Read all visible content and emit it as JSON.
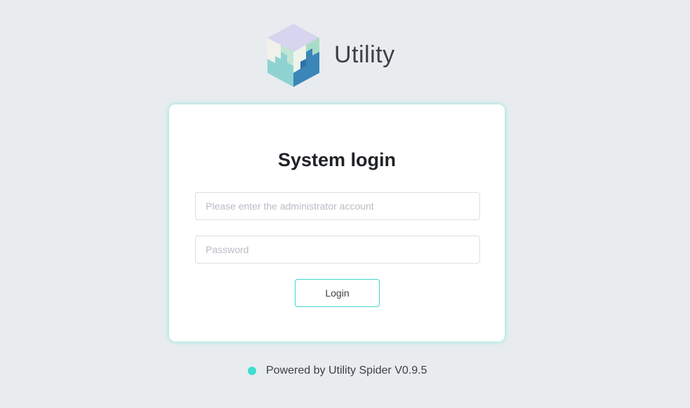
{
  "brand": {
    "name": "Utility",
    "logo_icon": "utility-cube-logo"
  },
  "login": {
    "title": "System login",
    "account_placeholder": "Please enter the administrator account",
    "account_value": "",
    "password_placeholder": "Password",
    "password_value": "",
    "submit_label": "Login"
  },
  "footer": {
    "status_icon": "status-dot",
    "text": "Powered by Utility Spider V0.9.5"
  },
  "colors": {
    "background": "#e8ecef",
    "accent": "#40ddcf",
    "card": "#ffffff",
    "text": "#3c3f44"
  }
}
